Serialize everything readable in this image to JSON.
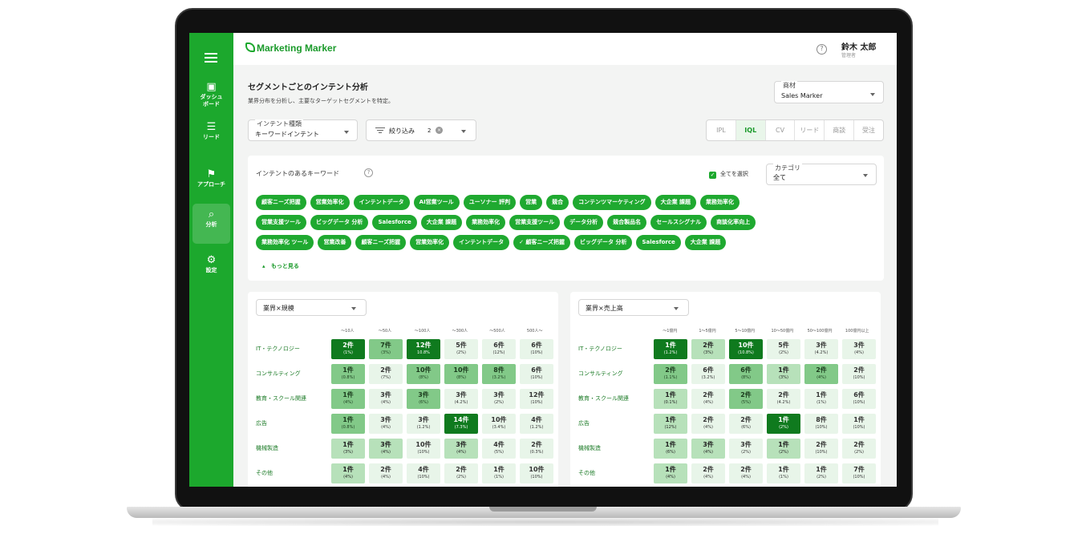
{
  "app": {
    "logo": "Marketing Marker"
  },
  "user": {
    "name": "鈴木 太郎",
    "role": "管理者"
  },
  "sidebar": {
    "items": [
      {
        "label": "ダッシュ\nボード",
        "icon": "dashboard-icon",
        "glyph": "▣"
      },
      {
        "label": "リード",
        "icon": "list-icon",
        "glyph": "☰"
      },
      {
        "label": "アプローチ",
        "icon": "flag-icon",
        "glyph": "⚑"
      },
      {
        "label": "分析",
        "icon": "analysis-icon",
        "glyph": "⌕"
      },
      {
        "label": "設定",
        "icon": "gear-icon",
        "glyph": "⚙"
      }
    ]
  },
  "page": {
    "title": "セグメントごとのインテント分析",
    "description": "業界分布を分析し、主要なターゲットセグメントを特定。"
  },
  "product_select": {
    "label": "商材",
    "value": "Sales Marker"
  },
  "intent_select": {
    "label": "インテント種類",
    "value": "キーワードインテント"
  },
  "filter": {
    "label": "絞り込み",
    "count": "2"
  },
  "stages": [
    "IPL",
    "IQL",
    "CV",
    "リード",
    "商談",
    "受注"
  ],
  "active_stage": "IQL",
  "keywords": {
    "title": "インテントのあるキーワード",
    "select_all": "全てを選択",
    "category_label": "カテゴリ",
    "category_value": "全て",
    "more": "もっと見る",
    "rows": [
      [
        "顧客ニーズ把握",
        "営業効率化",
        "インテントデータ",
        "AI営業ツール",
        "ユーソナー 評判",
        "営業",
        "競合",
        "コンテンツマーケティング",
        "大企業 課題",
        "業務効率化"
      ],
      [
        "営業支援ツール",
        "ビッグデータ 分析",
        "Salesforce",
        "大企業 課題",
        "業務効率化",
        "営業支援ツール",
        "データ分析",
        "競合製品名",
        "セールスシグナル",
        "商談化率向上"
      ],
      [
        "業務効率化 ツール",
        "営業改善",
        "顧客ニーズ把握",
        "営業効率化",
        "インテントデータ",
        "✓ 顧客ニーズ把握",
        "ビッグデータ 分析",
        "Salesforce",
        "大企業 課題"
      ]
    ]
  },
  "heatmap_left": {
    "selector": "業界×規模",
    "columns": [
      "〜10人",
      "〜50人",
      "〜100人",
      "〜300人",
      "〜500人",
      "500人〜"
    ],
    "rows": [
      {
        "label": "IT・テクノロジー",
        "cells": [
          [
            "2件",
            "(1%)",
            3
          ],
          [
            "7件",
            "(3%)",
            2
          ],
          [
            "12件",
            "10.8%",
            3
          ],
          [
            "5件",
            "(2%)",
            0
          ],
          [
            "6件",
            "(12%)",
            0
          ],
          [
            "6件",
            "(10%)",
            0
          ]
        ]
      },
      {
        "label": "コンサルティング",
        "cells": [
          [
            "1件",
            "(0.8%)",
            2
          ],
          [
            "2件",
            "(7%)",
            0
          ],
          [
            "10件",
            "(8%)",
            2
          ],
          [
            "10件",
            "(8%)",
            2
          ],
          [
            "8件",
            "(3.2%)",
            2
          ],
          [
            "6件",
            "(10%)",
            0
          ]
        ]
      },
      {
        "label": "教育・スクール関連",
        "cells": [
          [
            "1件",
            "(4%)",
            2
          ],
          [
            "3件",
            "(4%)",
            0
          ],
          [
            "3件",
            "(6%)",
            2
          ],
          [
            "3件",
            "(4.2%)",
            0
          ],
          [
            "3件",
            "(2%)",
            0
          ],
          [
            "12件",
            "(10%)",
            0
          ]
        ]
      },
      {
        "label": "広告",
        "cells": [
          [
            "1件",
            "(0.8%)",
            2
          ],
          [
            "3件",
            "(4%)",
            0
          ],
          [
            "3件",
            "(1.2%)",
            0
          ],
          [
            "14件",
            "(7.3%)",
            3
          ],
          [
            "10件",
            "(3.4%)",
            0
          ],
          [
            "4件",
            "(1.2%)",
            0
          ]
        ]
      },
      {
        "label": "機械製造",
        "cells": [
          [
            "1件",
            "(3%)",
            1
          ],
          [
            "3件",
            "(4%)",
            1
          ],
          [
            "10件",
            "(10%)",
            0
          ],
          [
            "3件",
            "(4%)",
            1
          ],
          [
            "4件",
            "(5%)",
            0
          ],
          [
            "2件",
            "(0.3%)",
            0
          ]
        ]
      },
      {
        "label": "その他",
        "cells": [
          [
            "1件",
            "(4%)",
            1
          ],
          [
            "2件",
            "(4%)",
            0
          ],
          [
            "4件",
            "(10%)",
            0
          ],
          [
            "2件",
            "(2%)",
            0
          ],
          [
            "1件",
            "(1%)",
            0
          ],
          [
            "10件",
            "(10%)",
            0
          ]
        ]
      }
    ]
  },
  "heatmap_right": {
    "selector": "業界×売上高",
    "columns": [
      "〜1億円",
      "1〜5億円",
      "5〜10億円",
      "10〜50億円",
      "50〜100億円",
      "100億円以上"
    ],
    "rows": [
      {
        "label": "IT・テクノロジー",
        "cells": [
          [
            "1件",
            "(1.2%)",
            3
          ],
          [
            "2件",
            "(3%)",
            1
          ],
          [
            "10件",
            "(10.8%)",
            3
          ],
          [
            "5件",
            "(2%)",
            0
          ],
          [
            "3件",
            "(4.2%)",
            0
          ],
          [
            "3件",
            "(4%)",
            0
          ]
        ]
      },
      {
        "label": "コンサルティング",
        "cells": [
          [
            "2件",
            "(1.1%)",
            2
          ],
          [
            "6件",
            "(3.2%)",
            0
          ],
          [
            "6件",
            "(8%)",
            2
          ],
          [
            "1件",
            "(3%)",
            1
          ],
          [
            "2件",
            "(4%)",
            2
          ],
          [
            "2件",
            "(10%)",
            0
          ]
        ]
      },
      {
        "label": "教育・スクール関連",
        "cells": [
          [
            "1件",
            "(0.1%)",
            1
          ],
          [
            "2件",
            "(4%)",
            0
          ],
          [
            "2件",
            "(5%)",
            2
          ],
          [
            "2件",
            "(4.2%)",
            0
          ],
          [
            "1件",
            "(1%)",
            0
          ],
          [
            "6件",
            "(10%)",
            0
          ]
        ]
      },
      {
        "label": "広告",
        "cells": [
          [
            "1件",
            "(12%)",
            1
          ],
          [
            "2件",
            "(4%)",
            0
          ],
          [
            "2件",
            "(6%)",
            0
          ],
          [
            "1件",
            "(2%)",
            3
          ],
          [
            "8件",
            "(10%)",
            0
          ],
          [
            "1件",
            "(10%)",
            0
          ]
        ]
      },
      {
        "label": "機械製造",
        "cells": [
          [
            "1件",
            "(6%)",
            1
          ],
          [
            "3件",
            "(4%)",
            1
          ],
          [
            "3件",
            "(2%)",
            0
          ],
          [
            "1件",
            "(2%)",
            1
          ],
          [
            "2件",
            "(10%)",
            0
          ],
          [
            "2件",
            "(2%)",
            0
          ]
        ]
      },
      {
        "label": "その他",
        "cells": [
          [
            "1件",
            "(4%)",
            1
          ],
          [
            "2件",
            "(4%)",
            0
          ],
          [
            "2件",
            "(4%)",
            0
          ],
          [
            "1件",
            "(1%)",
            0
          ],
          [
            "1件",
            "(2%)",
            0
          ],
          [
            "7件",
            "(10%)",
            0
          ]
        ]
      }
    ]
  }
}
